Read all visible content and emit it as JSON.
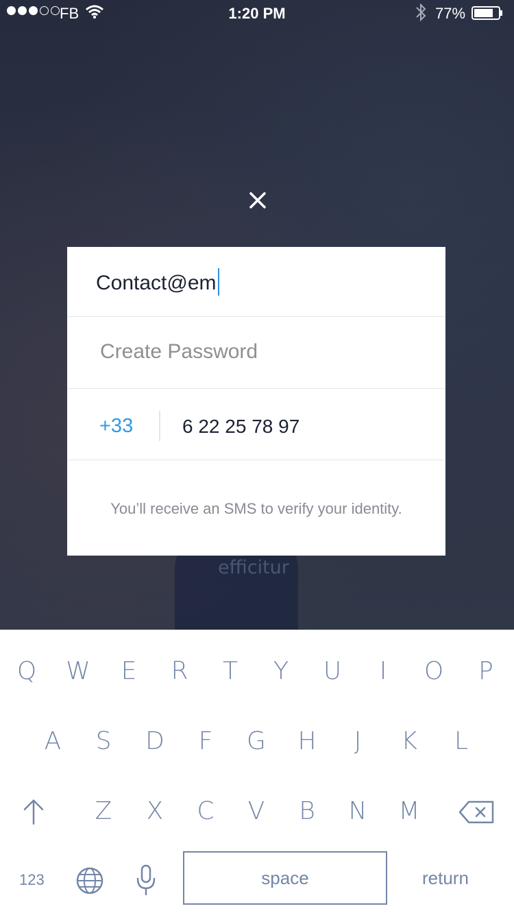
{
  "status_bar": {
    "carrier": "FB",
    "time": "1:20 PM",
    "battery_percent": "77%",
    "signal_strength": 3,
    "signal_total": 5
  },
  "background": {
    "text": "efficitur"
  },
  "close_icon": "close-icon",
  "form": {
    "email_value": "Contact@em",
    "password_placeholder": "Create Password",
    "country_code": "+33",
    "phone_value": "6 22 25 78 97",
    "sms_note": "You’ll receive an SMS to verify your identity."
  },
  "colors": {
    "accent": "#2e9be0",
    "key_color": "#7486a6",
    "background": "#2a3142"
  },
  "keyboard": {
    "row1": [
      "Q",
      "W",
      "E",
      "R",
      "T",
      "Y",
      "U",
      "I",
      "O",
      "P"
    ],
    "row2": [
      "A",
      "S",
      "D",
      "F",
      "G",
      "H",
      "J",
      "K",
      "L"
    ],
    "row3": [
      "Z",
      "X",
      "C",
      "V",
      "B",
      "N",
      "M"
    ],
    "numbers_key": "123",
    "space_key": "space",
    "return_key": "return",
    "icons": [
      "shift-icon",
      "backspace-icon",
      "globe-icon",
      "microphone-icon"
    ]
  }
}
